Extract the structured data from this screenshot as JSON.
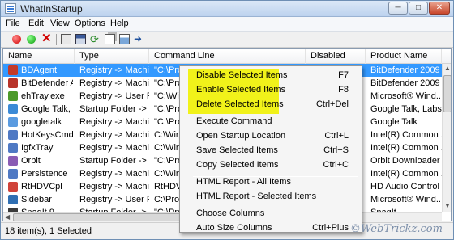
{
  "window": {
    "title": "WhatInStartup"
  },
  "window_buttons": {
    "minimize": "─",
    "maximize": "□",
    "close": "✕"
  },
  "menu": [
    "File",
    "Edit",
    "View",
    "Options",
    "Help"
  ],
  "toolbar_icons": [
    "disable-icon",
    "enable-icon",
    "delete-icon",
    "properties-icon",
    "save-icon",
    "refresh-icon",
    "copy-icon",
    "report-icon",
    "exit-icon"
  ],
  "columns": [
    "Name",
    "Type",
    "Command Line",
    "Disabled",
    "Product Name"
  ],
  "rows": [
    {
      "name": "BDAgent",
      "type": "Registry -> Machi...",
      "cmd": "\"C:\\Pro",
      "product": "BitDefender 2009",
      "icon": "#c33a2a"
    },
    {
      "name": "BitDefender A...",
      "type": "Registry -> Machi...",
      "cmd": "\"C:\\Pro",
      "product": "BitDefender 2009",
      "icon": "#b8342a"
    },
    {
      "name": "ehTray.exe",
      "type": "Registry -> User Run",
      "cmd": "\"C:\\Win",
      "product": "Microsoft® Wind...",
      "icon": "#4c9a2a"
    },
    {
      "name": "Google Talk, L...",
      "type": "Startup Folder -> ...",
      "cmd": "\"C:\\Pro",
      "product": "Google Talk, Labs ...",
      "icon": "#3b8ad6"
    },
    {
      "name": "googletalk",
      "type": "Registry -> Machi...",
      "cmd": "\"C:\\Pro",
      "product": "Google Talk",
      "icon": "#5a9be0"
    },
    {
      "name": "HotKeysCmds",
      "type": "Registry -> Machi...",
      "cmd": "C:\\Win",
      "product": "Intel(R) Common ...",
      "icon": "#4f79c4"
    },
    {
      "name": "IgfxTray",
      "type": "Registry -> Machi...",
      "cmd": "C:\\Win",
      "product": "Intel(R) Common ...",
      "icon": "#4f79c4"
    },
    {
      "name": "Orbit",
      "type": "Startup Folder -> ...",
      "cmd": "\"C:\\Pro",
      "product": "Orbit Downloader",
      "icon": "#8a5cb4"
    },
    {
      "name": "Persistence",
      "type": "Registry -> Machi...",
      "cmd": "C:\\Win",
      "product": "Intel(R) Common ...",
      "icon": "#4f79c4"
    },
    {
      "name": "RtHDVCpl",
      "type": "Registry -> Machi...",
      "cmd": "RtHDVC",
      "product": "HD Audio Control ...",
      "icon": "#d0433a"
    },
    {
      "name": "Sidebar",
      "type": "Registry -> User Run",
      "cmd": "C:\\Pro",
      "product": "Microsoft® Wind...",
      "icon": "#2f6fb3"
    },
    {
      "name": "SnagIt 9",
      "type": "Startup Folder -> ...",
      "cmd": "\"C:\\Pro",
      "product": "SnagIt",
      "icon": "#3b3b3b"
    }
  ],
  "context_menu": [
    {
      "label": "Disable Selected Items",
      "shortcut": "F7"
    },
    {
      "label": "Enable Selected Items",
      "shortcut": "F8"
    },
    {
      "label": "Delete Selected Items",
      "shortcut": "Ctrl+Del"
    },
    {
      "label": "Execute Command",
      "shortcut": ""
    },
    {
      "label": "Open Startup Location",
      "shortcut": "Ctrl+L"
    },
    {
      "label": "Save Selected Items",
      "shortcut": "Ctrl+S"
    },
    {
      "label": "Copy Selected Items",
      "shortcut": "Ctrl+C"
    },
    {
      "label": "HTML Report - All Items",
      "shortcut": ""
    },
    {
      "label": "HTML Report - Selected Items",
      "shortcut": ""
    },
    {
      "label": "Choose Columns",
      "shortcut": ""
    },
    {
      "label": "Auto Size Columns",
      "shortcut": "Ctrl+Plus"
    }
  ],
  "status": {
    "text": "18 item(s), 1 Selected"
  },
  "watermark": "©WebTrickz.com",
  "colors": {
    "selection": "#3399ff",
    "highlight": "#f1f21a"
  }
}
